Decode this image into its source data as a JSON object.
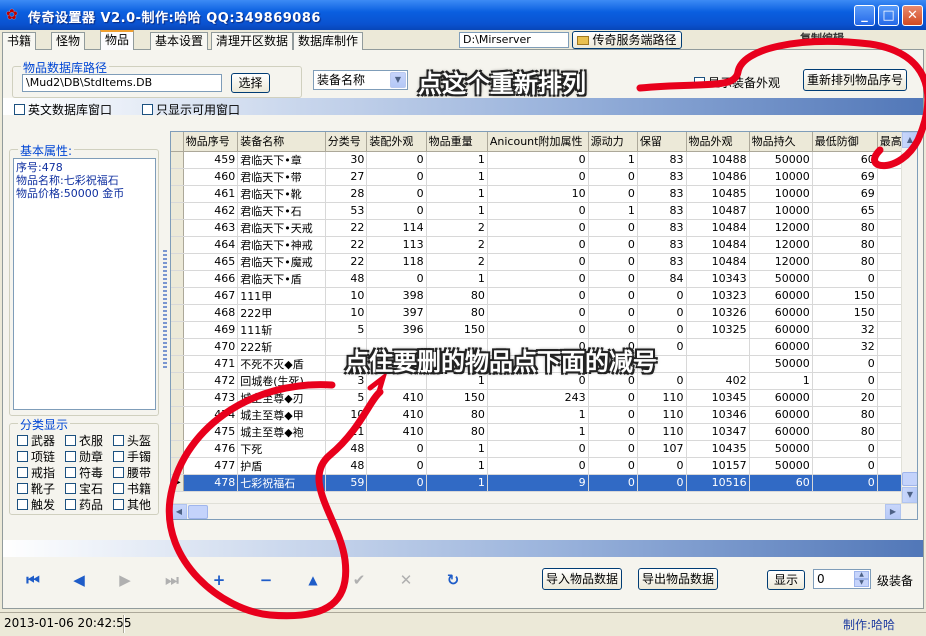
{
  "window": {
    "title": "传奇设置器 V2.0-制作:哈哈 QQ:349869086",
    "min_symbol": "_",
    "max_symbol": "□",
    "close_symbol": "✕"
  },
  "tabs": [
    {
      "label": "书籍"
    },
    {
      "label": "怪物"
    },
    {
      "label": "物品"
    },
    {
      "label": "基本设置"
    },
    {
      "label": "清理开区数据"
    },
    {
      "label": "数据库制作"
    }
  ],
  "server_path": {
    "value": "D:\\Mirserver",
    "button": "传奇服务端路径"
  },
  "obscured_label": "复制编辑",
  "db_path": {
    "group_label": "物品数据库路径",
    "value": "\\Mud2\\DB\\StdItems.DB",
    "button": "选择"
  },
  "filter_combo": {
    "selected": "装备名称",
    "arrow": "▼"
  },
  "options": {
    "show_equip_label": "显示装备外观",
    "renumber_button": "重新排列物品序号",
    "english_db_window": "英文数据库窗口",
    "show_only_available": "只显示可用窗口"
  },
  "basic_props": {
    "label": "基本属性:",
    "lines": [
      "序号:478",
      "物品名称:七彩祝福石",
      "物品价格:50000 金币"
    ]
  },
  "categories": {
    "label": "分类显示",
    "items": [
      "武器",
      "衣服",
      "头盔",
      "项链",
      "勋章",
      "手镯",
      "戒指",
      "符毒",
      "腰带",
      "靴子",
      "宝石",
      "书籍",
      "触发",
      "药品",
      "其他"
    ]
  },
  "table": {
    "columns": [
      "物品序号",
      "装备名称",
      "分类号",
      "装配外观",
      "物品重量",
      "Anicount附加属性",
      "源动力",
      "保留",
      "物品外观",
      "物品持久",
      "最低防御",
      "最高"
    ],
    "rows": [
      [
        "459",
        "君临天下•章",
        "30",
        "0",
        "1",
        "0",
        "1",
        "83",
        "10488",
        "50000",
        "60",
        ""
      ],
      [
        "460",
        "君临天下•带",
        "27",
        "0",
        "1",
        "0",
        "0",
        "83",
        "10486",
        "10000",
        "69",
        ""
      ],
      [
        "461",
        "君临天下•靴",
        "28",
        "0",
        "1",
        "10",
        "0",
        "83",
        "10485",
        "10000",
        "69",
        ""
      ],
      [
        "462",
        "君临天下•石",
        "53",
        "0",
        "1",
        "0",
        "1",
        "83",
        "10487",
        "10000",
        "65",
        ""
      ],
      [
        "463",
        "君临天下•天戒",
        "22",
        "114",
        "2",
        "0",
        "0",
        "83",
        "10484",
        "12000",
        "80",
        ""
      ],
      [
        "464",
        "君临天下•神戒",
        "22",
        "113",
        "2",
        "0",
        "0",
        "83",
        "10484",
        "12000",
        "80",
        ""
      ],
      [
        "465",
        "君临天下•魔戒",
        "22",
        "118",
        "2",
        "0",
        "0",
        "83",
        "10484",
        "12000",
        "80",
        ""
      ],
      [
        "466",
        "君临天下•盾",
        "48",
        "0",
        "1",
        "0",
        "0",
        "84",
        "10343",
        "50000",
        "0",
        ""
      ],
      [
        "467",
        "111甲",
        "10",
        "398",
        "80",
        "0",
        "0",
        "0",
        "10323",
        "60000",
        "150",
        ""
      ],
      [
        "468",
        "222甲",
        "10",
        "397",
        "80",
        "0",
        "0",
        "0",
        "10326",
        "60000",
        "150",
        ""
      ],
      [
        "469",
        "111斩",
        "5",
        "396",
        "150",
        "0",
        "0",
        "0",
        "10325",
        "60000",
        "32",
        ""
      ],
      [
        "470",
        "222斩",
        "",
        "",
        "",
        "0",
        "0",
        "0",
        "",
        "60000",
        "32",
        ""
      ],
      [
        "471",
        "不死不灭◆盾",
        "",
        "",
        "",
        "",
        "",
        "",
        "",
        "50000",
        "0",
        ""
      ],
      [
        "472",
        "回城卷(生死)",
        "3",
        "",
        "1",
        "0",
        "0",
        "0",
        "402",
        "1",
        "0",
        ""
      ],
      [
        "473",
        "城主至尊◆刃",
        "5",
        "410",
        "150",
        "243",
        "0",
        "110",
        "10345",
        "60000",
        "20",
        ""
      ],
      [
        "474",
        "城主至尊◆甲",
        "10",
        "410",
        "80",
        "1",
        "0",
        "110",
        "10346",
        "60000",
        "80",
        ""
      ],
      [
        "475",
        "城主至尊◆袍",
        "11",
        "410",
        "80",
        "1",
        "0",
        "110",
        "10347",
        "60000",
        "80",
        ""
      ],
      [
        "476",
        "下死",
        "48",
        "0",
        "1",
        "0",
        "0",
        "107",
        "10435",
        "50000",
        "0",
        ""
      ],
      [
        "477",
        "护盾",
        "48",
        "0",
        "1",
        "0",
        "0",
        "0",
        "10157",
        "50000",
        "0",
        ""
      ],
      [
        "478",
        "七彩祝福石",
        "59",
        "0",
        "1",
        "9",
        "0",
        "0",
        "10516",
        "60",
        "0",
        ""
      ]
    ],
    "selected_index": 19,
    "row_indicator": "▶"
  },
  "navigator": {
    "first": "⏮",
    "prev": "◀",
    "next": "▶",
    "last": "⏭",
    "insert": "+",
    "delete": "−",
    "edit": "▲",
    "post": "✔",
    "cancel": "✕",
    "refresh": "↻"
  },
  "bottom": {
    "import_button": "导入物品数据",
    "export_button": "导出物品数据",
    "show_button": "显示",
    "level_value": "0",
    "level_label": "级装备"
  },
  "status": {
    "datetime": "2013-01-06 20:42:55",
    "author": "制作:哈哈"
  },
  "annotations": {
    "top": "点这个重新排列",
    "middle": "点住要删的物品点下面的减号"
  },
  "colors": {
    "annotation_red": "#e8001c",
    "selection_blue": "#316ac5",
    "title_blue": "#0a52d0"
  }
}
